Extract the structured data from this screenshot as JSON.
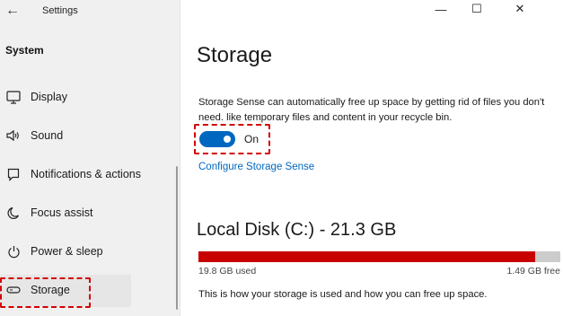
{
  "app": {
    "title": "Settings"
  },
  "sidebar": {
    "section_title": "System",
    "items": [
      {
        "label": "Display",
        "icon": "monitor-icon"
      },
      {
        "label": "Sound",
        "icon": "speaker-icon"
      },
      {
        "label": "Notifications & actions",
        "icon": "notification-icon"
      },
      {
        "label": "Focus assist",
        "icon": "moon-icon"
      },
      {
        "label": "Power & sleep",
        "icon": "power-icon"
      },
      {
        "label": "Storage",
        "icon": "storage-icon",
        "selected": true
      }
    ]
  },
  "window_controls": {
    "minimize": "—",
    "maximize": "☐",
    "close": "✕"
  },
  "main": {
    "title": "Storage",
    "storage_sense": {
      "description": "Storage Sense can automatically free up space by getting rid of files you don't need. like temporary files and content in your recycle bin.",
      "toggle_state": "On",
      "toggle_on": true,
      "configure_link": "Configure Storage Sense"
    },
    "disk": {
      "title": "Local Disk (C:) - 21.3 GB",
      "used": "19.8 GB used",
      "free": "1.49 GB free",
      "used_fraction": 0.93,
      "description": "This is how your storage is used and how you can free up space."
    }
  },
  "colors": {
    "accent": "#0067c0",
    "usage_bar": "#c80000",
    "highlight": "#d40000"
  }
}
